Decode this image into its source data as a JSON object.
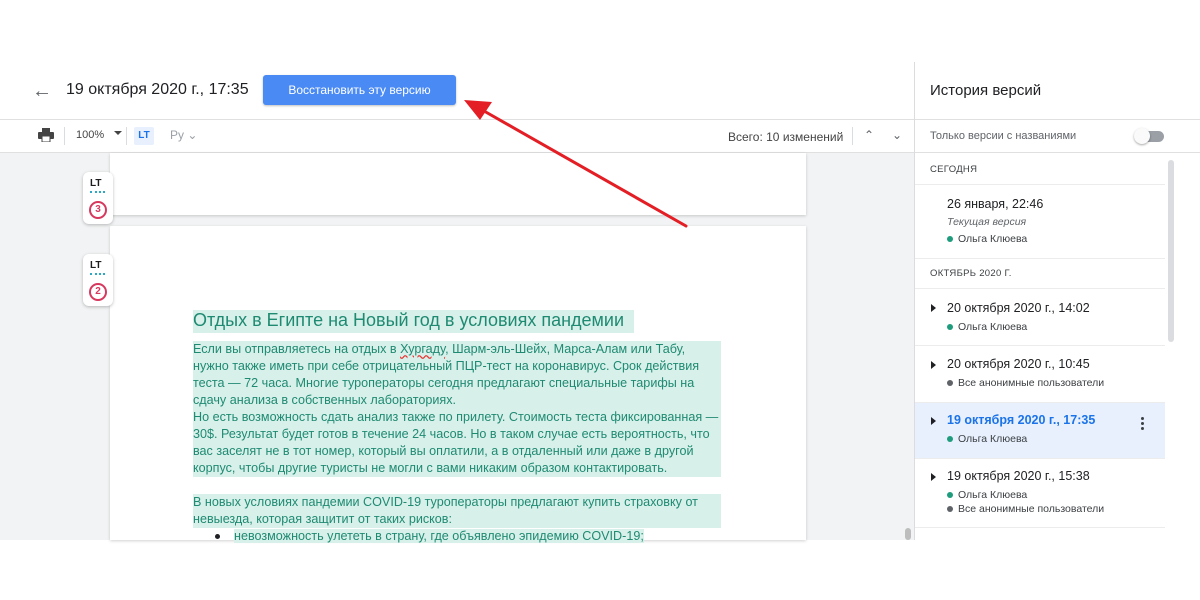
{
  "header": {
    "version_title": "19 октября 2020 г., 17:35",
    "restore_button": "Восстановить эту версию"
  },
  "toolbar": {
    "zoom": "100%",
    "lt_icon_text": "LT",
    "rus_label": "Ру",
    "total_changes": "Всего: 10 изменений"
  },
  "lt_badges": [
    {
      "label": "LT",
      "count": "3"
    },
    {
      "label": "LT",
      "count": "2"
    }
  ],
  "document": {
    "title": "Отдых в Египте на Новый год в условиях пандемии",
    "para1_a": "Если вы отправляетесь на отдых в ",
    "para1_spell": "Хургаду",
    "para1_b": ", Шарм-эль-Шейх, Марса-Алам или Табу, нужно также иметь при себе отрицательный ПЦР-тест на коронавирус. Срок действия теста — 72 часа. Многие туроператоры сегодня предлагают специальные тарифы на сдачу анализа в собственных лабораториях.",
    "para2": "Но есть возможность сдать анализ также по прилету. Стоимость теста фиксированная — 30$. Результат будет готов в течение 24 часов. Но в таком случае есть вероятность, что вас заселят не в тот номер, который вы оплатили, а в отдаленный или даже в другой корпус, чтобы другие туристы не могли с вами никаким образом контактировать.",
    "para3": "В новых условиях пандемии COVID-19 туроператоры предлагают купить страховку от невыезда, которая защитит от таких рисков:",
    "bullet1": "невозможность улететь в страну, где объявлено эпидемию COVID-19;"
  },
  "panel": {
    "title": "История версий",
    "named_only_label": "Только версии с названиями",
    "section_today": "Сегодня",
    "section_october": "Октябрь 2020 г.",
    "versions": [
      {
        "time": "26 января, 22:46",
        "subtitle": "Текущая версия",
        "users": [
          "Ольга Клюева"
        ]
      },
      {
        "time": "20 октября 2020 г., 14:02",
        "users": [
          "Ольга Клюева"
        ]
      },
      {
        "time": "20 октября 2020 г., 10:45",
        "users": [
          "Все анонимные пользователи"
        ]
      },
      {
        "time": "19 октября 2020 г., 17:35",
        "users": [
          "Ольга Клюева"
        ],
        "selected": true
      },
      {
        "time": "19 октября 2020 г., 15:38",
        "users": [
          "Ольга Клюева",
          "Все анонимные пользователи"
        ]
      }
    ]
  },
  "colors": {
    "accent": "#4a8af4",
    "highlight": "#d7f0ea",
    "highlight_text": "#1f8a72",
    "user_olga": "#1e9c7d",
    "user_anon": "#5f6368",
    "annotation_arrow": "#e31e24"
  }
}
